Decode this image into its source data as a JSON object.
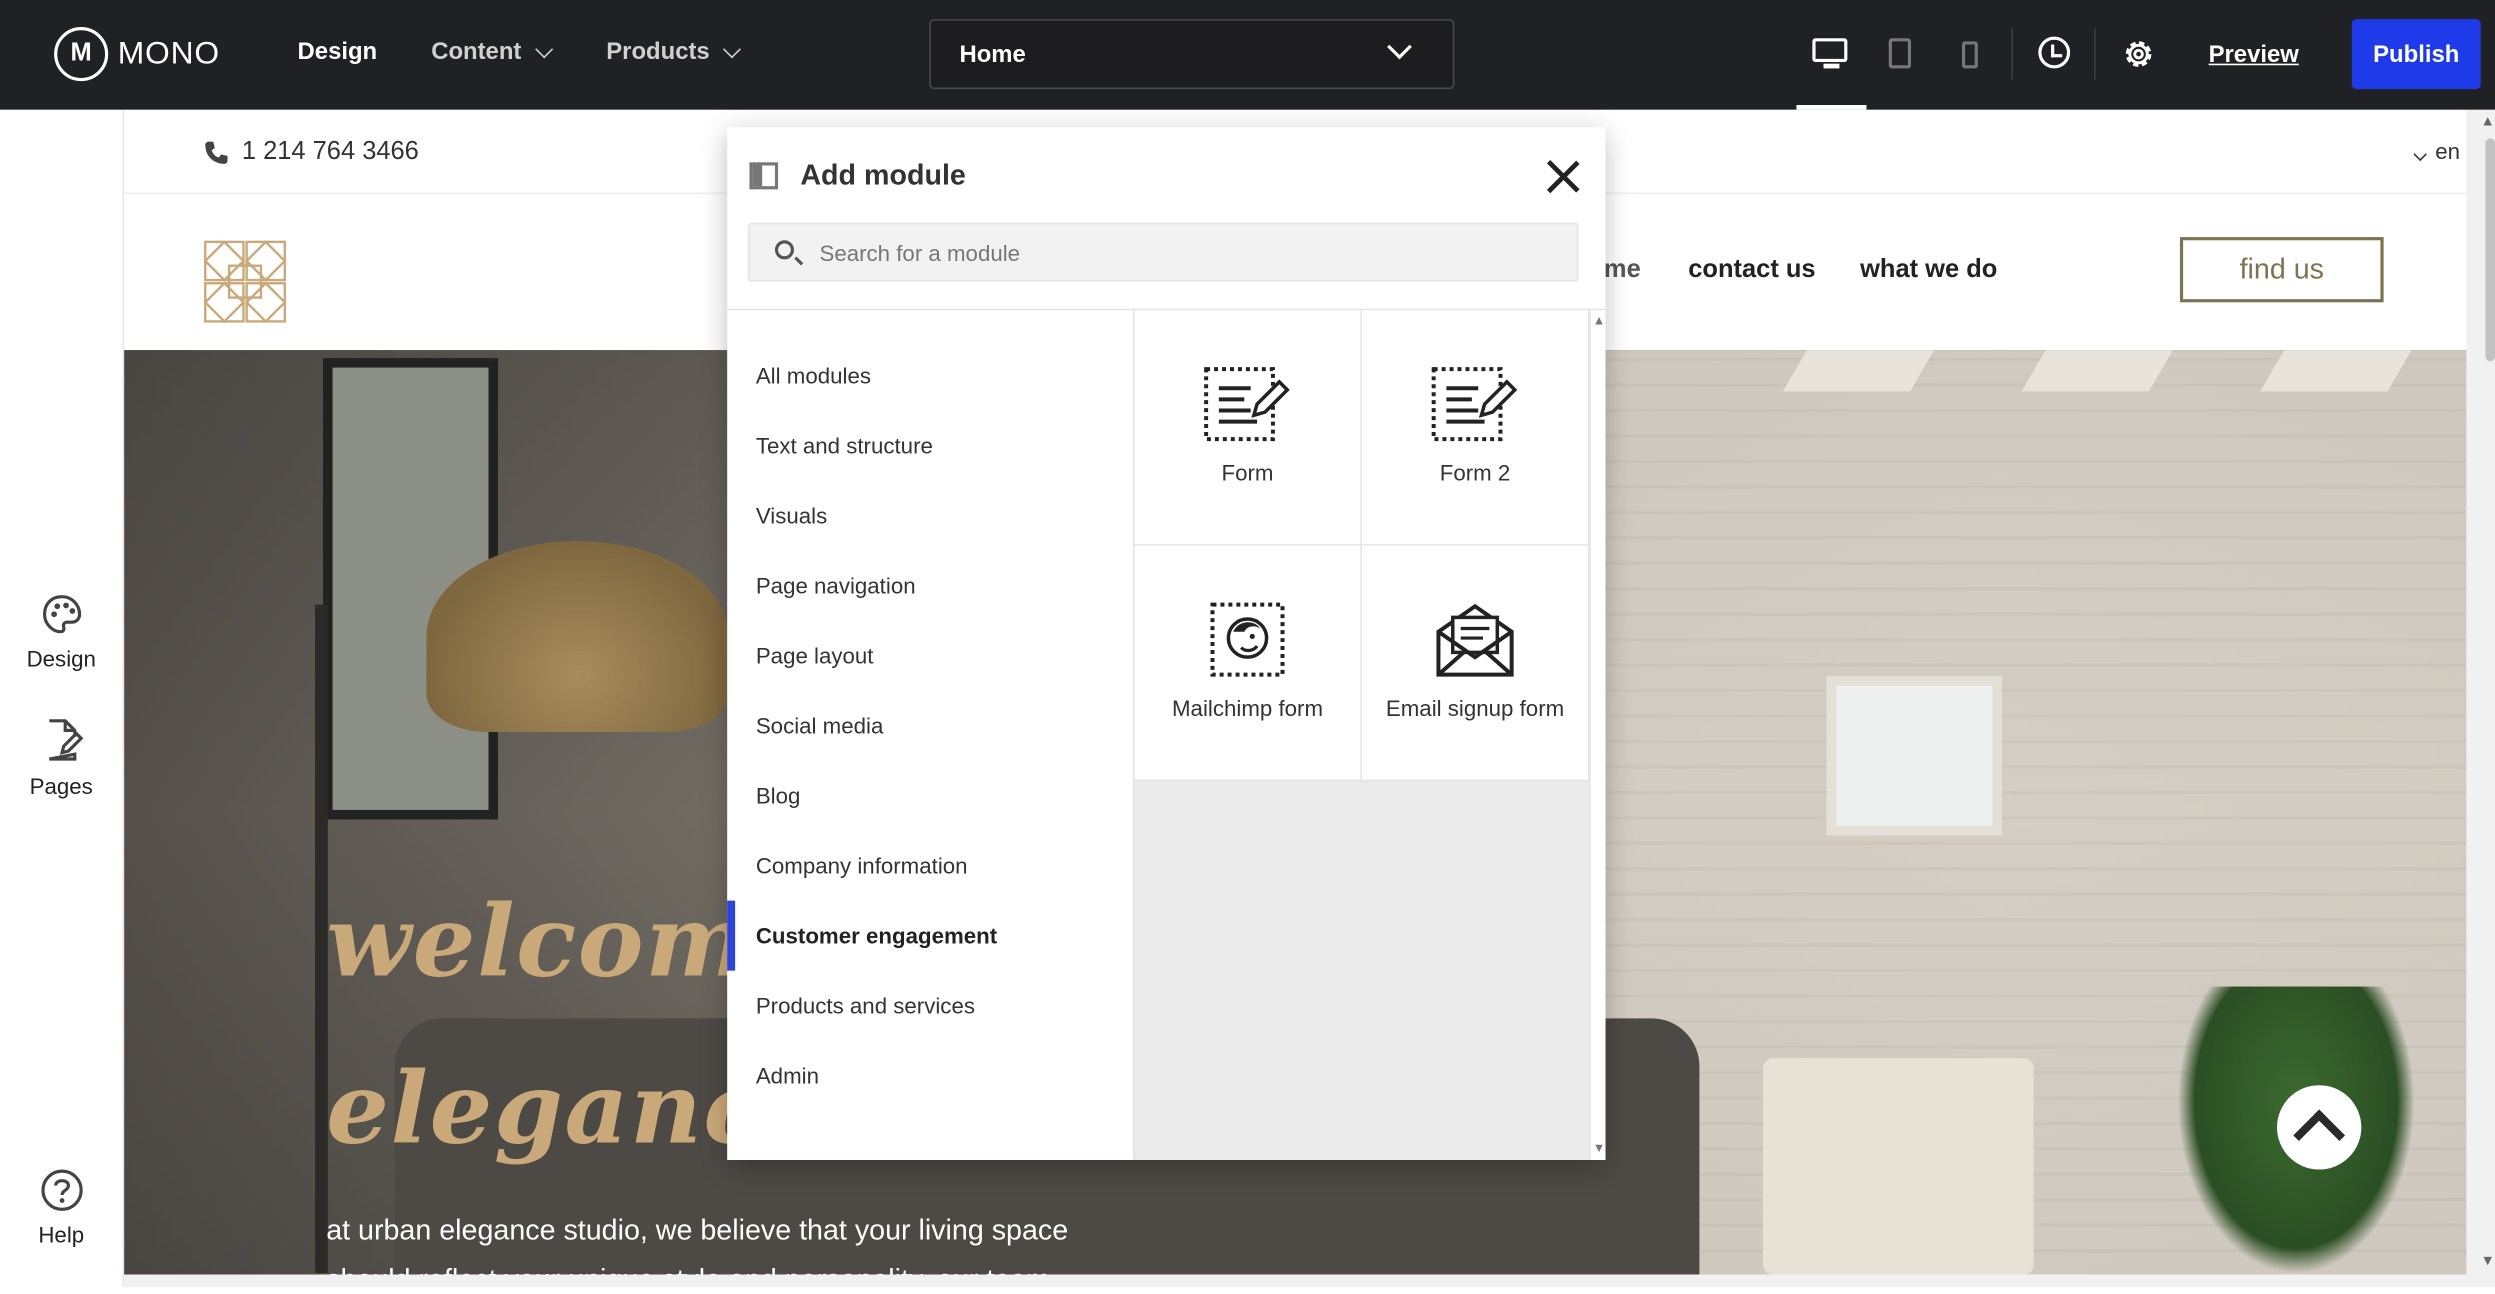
{
  "topbar": {
    "logo_text": "MONO",
    "nav": [
      "Design",
      "Content",
      "Products"
    ],
    "page_select": "Home",
    "preview_label": "Preview",
    "publish_label": "Publish"
  },
  "leftrail": {
    "design_label": "Design",
    "pages_label": "Pages",
    "help_label": "Help"
  },
  "site": {
    "phone": "1 214 764 3466",
    "lang": "en",
    "nav_partial": "me",
    "nav": [
      "contact us",
      "what we do"
    ],
    "cta": "find us",
    "hero_line1": "welcome t",
    "hero_line2": "elegance s",
    "hero_text": "at urban elegance studio, we believe that your living space should reflect your unique style and personality. our team"
  },
  "modal": {
    "title": "Add module",
    "search_placeholder": "Search for a module",
    "categories": [
      "All modules",
      "Text and structure",
      "Visuals",
      "Page navigation",
      "Page layout",
      "Social media",
      "Blog",
      "Company information",
      "Customer engagement",
      "Products and services",
      "Admin"
    ],
    "selected_category": "Customer engagement",
    "modules": [
      {
        "label": "Form",
        "icon": "form-icon"
      },
      {
        "label": "Form 2",
        "icon": "form-icon"
      },
      {
        "label": "Mailchimp form",
        "icon": "mailchimp-icon"
      },
      {
        "label": "Email signup form",
        "icon": "envelope-icon"
      }
    ]
  },
  "colors": {
    "topbar_bg": "#202124",
    "publish_bg": "#1f3be9",
    "selected_accent": "#2e44d8",
    "brand_gold": "#c9a97a"
  }
}
